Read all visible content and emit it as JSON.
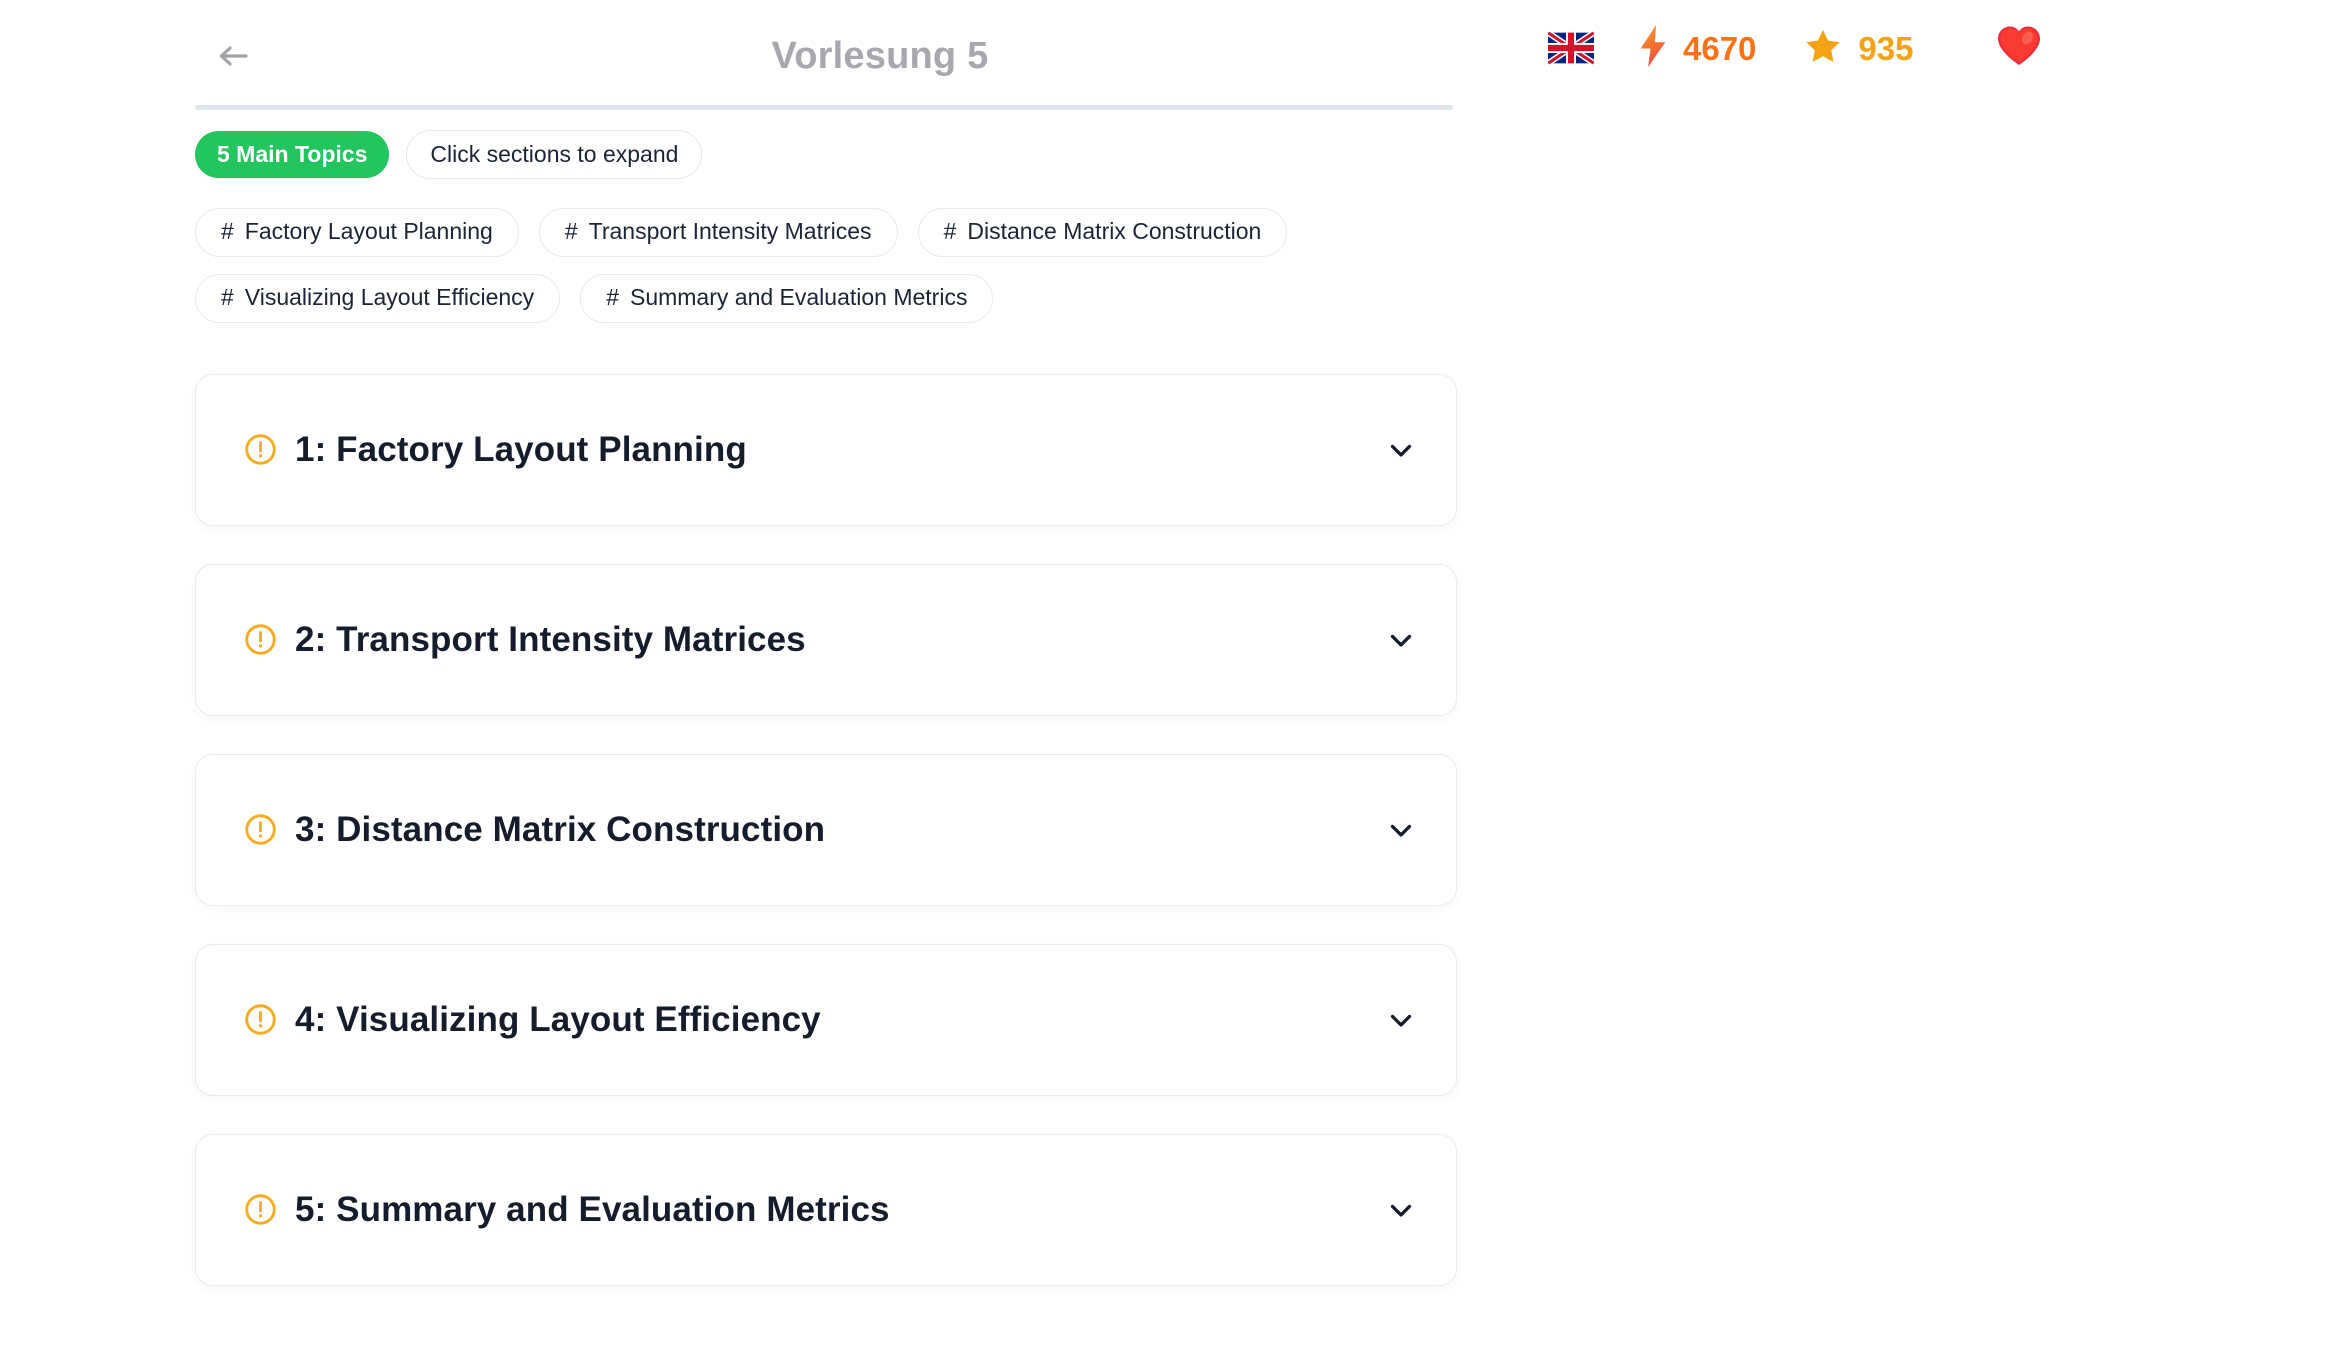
{
  "header": {
    "back_icon": "arrow-left-icon",
    "title": "Vorlesung 5"
  },
  "stats": {
    "language_flag": "uk-flag-icon",
    "streak": {
      "icon": "lightning-bolt-icon",
      "value": "4670",
      "color": "#f97316"
    },
    "points": {
      "icon": "star-icon",
      "value": "935",
      "color": "#f5a314"
    },
    "favorite": {
      "icon": "heart-icon",
      "color": "#ef2b2d"
    }
  },
  "toolbar": {
    "topics_badge": "5 Main Topics",
    "hint_label": "Click sections to expand"
  },
  "tags": [
    {
      "hash": "#",
      "label": "Factory Layout Planning"
    },
    {
      "hash": "#",
      "label": "Transport Intensity Matrices"
    },
    {
      "hash": "#",
      "label": "Distance Matrix Construction"
    },
    {
      "hash": "#",
      "label": "Visualizing Layout Efficiency"
    },
    {
      "hash": "#",
      "label": "Summary and Evaluation Metrics"
    }
  ],
  "sections": [
    {
      "title": "1: Factory Layout Planning",
      "status_icon": "alert-circle-icon",
      "expand_icon": "chevron-down-icon"
    },
    {
      "title": "2: Transport Intensity Matrices",
      "status_icon": "alert-circle-icon",
      "expand_icon": "chevron-down-icon"
    },
    {
      "title": "3: Distance Matrix Construction",
      "status_icon": "alert-circle-icon",
      "expand_icon": "chevron-down-icon"
    },
    {
      "title": "4: Visualizing Layout Efficiency",
      "status_icon": "alert-circle-icon",
      "expand_icon": "chevron-down-icon"
    },
    {
      "title": "5: Summary and Evaluation Metrics",
      "status_icon": "alert-circle-icon",
      "expand_icon": "chevron-down-icon"
    }
  ],
  "colors": {
    "accent_green": "#22c55e",
    "warning_amber": "#f9ab1e",
    "text_dark": "#151c2c",
    "title_gray": "#a7a7ad",
    "border": "#e7ebf2"
  }
}
